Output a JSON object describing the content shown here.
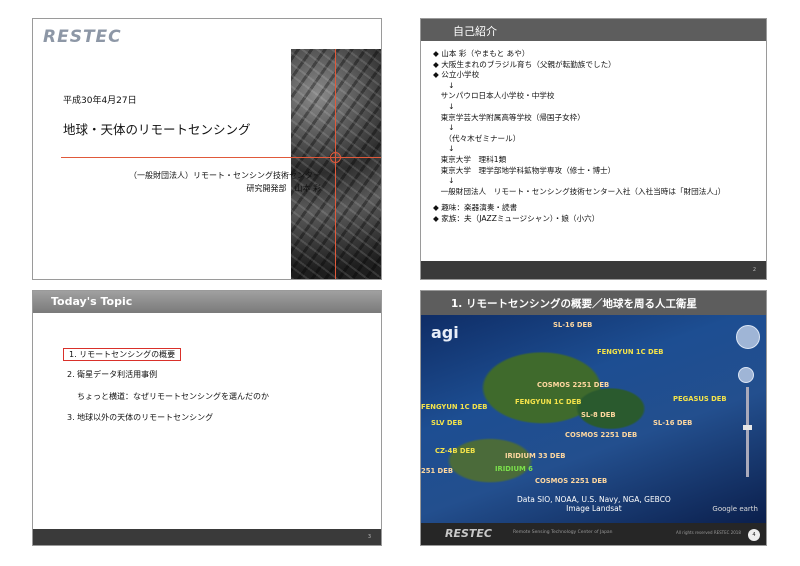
{
  "slide1": {
    "logo": "RESTEC",
    "date": "平成30年4月27日",
    "title": "地球・天体のリモートセンシング",
    "org_line1": "（一般財団法人）リモート・センシング技術センター",
    "org_line2": "研究開発部　山本 彩"
  },
  "slide2": {
    "header": "自己紹介",
    "lines": [
      "◆ 山本 彩（やまもと あや）",
      "◆ 大阪生まれのブラジル育ち（父親が転勤族でした）",
      "◆ 公立小学校",
      "　　↓",
      "　サンパウロ日本人小学校・中学校",
      "　　↓",
      "　東京学芸大学附属高等学校（帰国子女枠）",
      "　　↓",
      "　　（代々木ゼミナール）",
      "　　↓",
      "　東京大学　理科1類",
      "　東京大学　理学部地学科鉱物学専攻（修士・博士）",
      "　　↓",
      "　一般財団法人　リモート・センシング技術センター入社（入社当時は「財団法人」）",
      "",
      "◆ 趣味：楽器演奏・読書",
      "◆ 家族：夫（JAZZミュージシャン）・娘（小六）"
    ],
    "page": "2"
  },
  "slide3": {
    "header": "Today's Topic",
    "items": [
      "1.  リモートセンシングの概要",
      "2.  衛星データ利活用事例",
      "ちょっと横道：なぜリモートセンシングを選んだのか",
      "3.  地球以外の天体のリモートセンシング"
    ],
    "page": "3"
  },
  "slide4": {
    "header": "1. リモートセンシングの概要／地球を周る人工衛星",
    "logo": "agi",
    "satellites": [
      {
        "name": "SL-16 DEB",
        "style": "w"
      },
      {
        "name": "FENGYUN 1C DEB",
        "style": "y"
      },
      {
        "name": "COSMOS 2251 DEB",
        "style": "w"
      },
      {
        "name": "FENGYUN 1C DEB",
        "style": "y"
      },
      {
        "name": "SL-8 DEB",
        "style": "w"
      },
      {
        "name": "PEGASUS DEB",
        "style": "y"
      },
      {
        "name": "FENGYUN 1C DEB",
        "style": "y"
      },
      {
        "name": "SL-16 DEB",
        "style": "w"
      },
      {
        "name": "SLV DEB",
        "style": "y"
      },
      {
        "name": "COSMOS 2251 DEB",
        "style": "w"
      },
      {
        "name": "CZ-4B DEB",
        "style": "y"
      },
      {
        "name": "IRIDIUM 33 DEB",
        "style": "w"
      },
      {
        "name": "IRIDIUM 6",
        "style": "g"
      },
      {
        "name": "COSMOS 2251 DEB",
        "style": "w"
      },
      {
        "name": "251 DEB",
        "style": "w"
      }
    ],
    "credit_line1": "Data SIO, NOAA, U.S. Navy, NGA, GEBCO",
    "credit_line2": "Image Landsat",
    "map_credit": "Google earth",
    "footer_logo": "RESTEC",
    "footer_sub": "Remote Sensing Technology Center of Japan",
    "footer_rights": "All rights reserved RESTEC 2018",
    "page": "4"
  }
}
